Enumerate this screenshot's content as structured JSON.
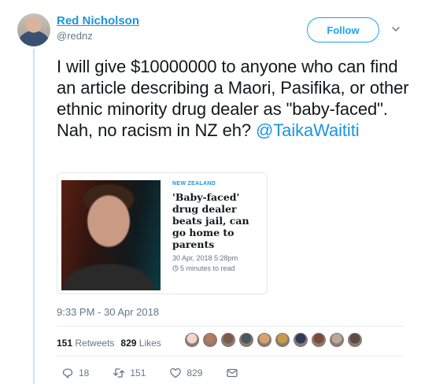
{
  "author": {
    "name": "Red Nicholson",
    "handle": "@rednz"
  },
  "follow_label": "Follow",
  "tweet": {
    "text": "I will give $10000000 to anyone who can find an article describing a Maori, Pasifika, or other ethnic minority drug dealer as \"baby-faced\". Nah, no racism in NZ eh? ",
    "mention": "@TaikaWaititi"
  },
  "card": {
    "category": "NEW ZEALAND",
    "title": "'Baby-faced' drug dealer beats jail, can go home to parents",
    "date": "30 Apr, 2018 5:28pm",
    "read_time": "5 minutes to read"
  },
  "timestamp": "9:33 PM - 30 Apr 2018",
  "stats": {
    "retweets_count": "151",
    "retweets_label": "Retweets",
    "likes_count": "829",
    "likes_label": "Likes"
  },
  "actions": {
    "reply_count": "18",
    "retweet_count": "151",
    "like_count": "829"
  },
  "colors": {
    "accent": "#1da1f2",
    "link": "#1b95e0",
    "muted": "#657786"
  },
  "liker_colors": [
    "#f1d6cf",
    "#b07a63",
    "#7a5a4a",
    "#4a5660",
    "#d8a070",
    "#c89a4a",
    "#2f3a5a",
    "#7b4b3a",
    "#b7a89a",
    "#5d4b44"
  ]
}
